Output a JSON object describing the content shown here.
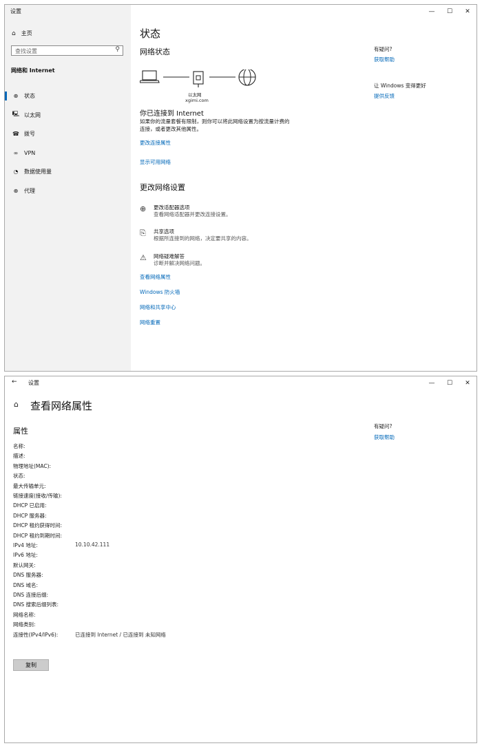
{
  "window1": {
    "title": "设置",
    "controls": {
      "minimize": "—",
      "maximize": "☐",
      "close": "✕"
    },
    "sidebar": {
      "home": "主页",
      "search_placeholder": "查找设置",
      "section": "网络和 Internet",
      "items": [
        {
          "icon": "status-icon",
          "glyph": "⊕",
          "label": "状态",
          "selected": true
        },
        {
          "icon": "ethernet-icon",
          "glyph": "🖳",
          "label": "以太网"
        },
        {
          "icon": "dialup-icon",
          "glyph": "☎",
          "label": "拨号"
        },
        {
          "icon": "vpn-icon",
          "glyph": "∞",
          "label": "VPN"
        },
        {
          "icon": "data-usage-icon",
          "glyph": "◔",
          "label": "数据使用量"
        },
        {
          "icon": "proxy-icon",
          "glyph": "⊕",
          "label": "代理"
        }
      ]
    },
    "main": {
      "page_title": "状态",
      "network_status_heading": "网络状态",
      "diagram": {
        "adapter_label": "以太网",
        "network_name": "xgimi.com"
      },
      "connected_heading": "你已连接到 Internet",
      "connected_desc_line1": "如果你的流量套餐有限制，则你可以将此网络设置为按流量计费的",
      "connected_desc_line2": "连接，或者更改其他属性。",
      "change_connection_properties": "更改连接属性",
      "show_available_networks": "显示可用网络",
      "change_settings_heading": "更改网络设置",
      "options": [
        {
          "icon": "adapter-options-icon",
          "glyph": "⊕",
          "title": "更改适配器选项",
          "desc": "查看网络适配器并更改连接设置。"
        },
        {
          "icon": "sharing-options-icon",
          "glyph": "⎘",
          "title": "共享选项",
          "desc": "根据所连接到的网络，决定要共享的内容。"
        },
        {
          "icon": "troubleshoot-icon",
          "glyph": "⚠",
          "title": "网络疑难解答",
          "desc": "诊断并解决网络问题。"
        }
      ],
      "links": [
        "查看网络属性",
        "Windows 防火墙",
        "网络和共享中心",
        "网络重置"
      ]
    },
    "right": {
      "question": "有疑问?",
      "get_help": "获取帮助",
      "improve": "让 Windows 变得更好",
      "feedback": "提供反馈"
    }
  },
  "window2": {
    "title": "设置",
    "back": "←",
    "controls": {
      "minimize": "—",
      "maximize": "☐",
      "close": "✕"
    },
    "page_title": "查看网络属性",
    "section": "属性",
    "properties": [
      {
        "label": "名称:",
        "value": ""
      },
      {
        "label": "描述:",
        "value": ""
      },
      {
        "label": "物理地址(MAC):",
        "value": ""
      },
      {
        "label": "状态:",
        "value": ""
      },
      {
        "label": "最大传输单元:",
        "value": ""
      },
      {
        "label": "链接速度(接收/传输):",
        "value": ""
      },
      {
        "label": "DHCP 已启用:",
        "value": ""
      },
      {
        "label": "DHCP 服务器:",
        "value": ""
      },
      {
        "label": "DHCP 租约获得时间:",
        "value": ""
      },
      {
        "label": "DHCP 租约到期时间:",
        "value": ""
      },
      {
        "label": "IPv4 地址:",
        "value": "10.10.42.111"
      },
      {
        "label": "IPv6 地址:",
        "value": ""
      },
      {
        "label": "默认网关:",
        "value": ""
      },
      {
        "label": "DNS 服务器:",
        "value": ""
      },
      {
        "label": "DNS 域名:",
        "value": ""
      },
      {
        "label": "DNS 连接后缀:",
        "value": ""
      },
      {
        "label": "DNS 搜索后缀列表:",
        "value": ""
      },
      {
        "label": "网络名称:",
        "value": ""
      },
      {
        "label": "网络类别:",
        "value": ""
      },
      {
        "label": "连接性(IPv4/IPv6):",
        "value": "已连接到 Internet / 已连接到 未知网络"
      }
    ],
    "copy_button": "复制",
    "right": {
      "question": "有疑问?",
      "get_help": "获取帮助"
    }
  },
  "colors": {
    "accent": "#0067b8",
    "sidebar_bg": "#f2f2f2",
    "button_bg": "#cccccc"
  }
}
